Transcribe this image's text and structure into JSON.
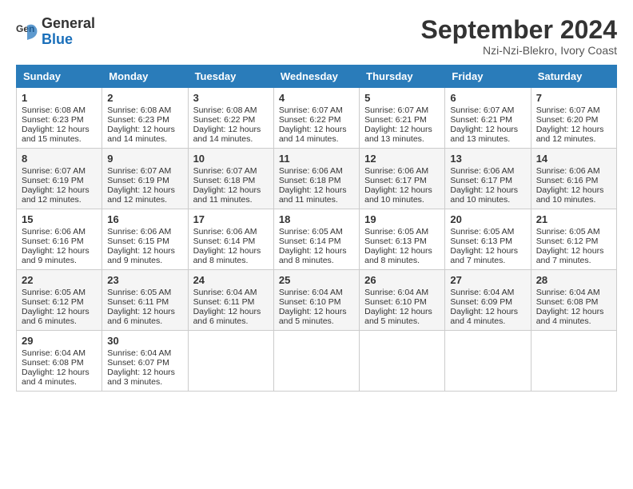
{
  "header": {
    "logo_line1": "General",
    "logo_line2": "Blue",
    "month": "September 2024",
    "location": "Nzi-Nzi-Blekro, Ivory Coast"
  },
  "weekdays": [
    "Sunday",
    "Monday",
    "Tuesday",
    "Wednesday",
    "Thursday",
    "Friday",
    "Saturday"
  ],
  "weeks": [
    [
      {
        "day": "1",
        "sunrise": "6:08 AM",
        "sunset": "6:23 PM",
        "daylight": "12 hours and 15 minutes."
      },
      {
        "day": "2",
        "sunrise": "6:08 AM",
        "sunset": "6:23 PM",
        "daylight": "12 hours and 14 minutes."
      },
      {
        "day": "3",
        "sunrise": "6:08 AM",
        "sunset": "6:22 PM",
        "daylight": "12 hours and 14 minutes."
      },
      {
        "day": "4",
        "sunrise": "6:07 AM",
        "sunset": "6:22 PM",
        "daylight": "12 hours and 14 minutes."
      },
      {
        "day": "5",
        "sunrise": "6:07 AM",
        "sunset": "6:21 PM",
        "daylight": "12 hours and 13 minutes."
      },
      {
        "day": "6",
        "sunrise": "6:07 AM",
        "sunset": "6:21 PM",
        "daylight": "12 hours and 13 minutes."
      },
      {
        "day": "7",
        "sunrise": "6:07 AM",
        "sunset": "6:20 PM",
        "daylight": "12 hours and 12 minutes."
      }
    ],
    [
      {
        "day": "8",
        "sunrise": "6:07 AM",
        "sunset": "6:19 PM",
        "daylight": "12 hours and 12 minutes."
      },
      {
        "day": "9",
        "sunrise": "6:07 AM",
        "sunset": "6:19 PM",
        "daylight": "12 hours and 12 minutes."
      },
      {
        "day": "10",
        "sunrise": "6:07 AM",
        "sunset": "6:18 PM",
        "daylight": "12 hours and 11 minutes."
      },
      {
        "day": "11",
        "sunrise": "6:06 AM",
        "sunset": "6:18 PM",
        "daylight": "12 hours and 11 minutes."
      },
      {
        "day": "12",
        "sunrise": "6:06 AM",
        "sunset": "6:17 PM",
        "daylight": "12 hours and 10 minutes."
      },
      {
        "day": "13",
        "sunrise": "6:06 AM",
        "sunset": "6:17 PM",
        "daylight": "12 hours and 10 minutes."
      },
      {
        "day": "14",
        "sunrise": "6:06 AM",
        "sunset": "6:16 PM",
        "daylight": "12 hours and 10 minutes."
      }
    ],
    [
      {
        "day": "15",
        "sunrise": "6:06 AM",
        "sunset": "6:16 PM",
        "daylight": "12 hours and 9 minutes."
      },
      {
        "day": "16",
        "sunrise": "6:06 AM",
        "sunset": "6:15 PM",
        "daylight": "12 hours and 9 minutes."
      },
      {
        "day": "17",
        "sunrise": "6:06 AM",
        "sunset": "6:14 PM",
        "daylight": "12 hours and 8 minutes."
      },
      {
        "day": "18",
        "sunrise": "6:05 AM",
        "sunset": "6:14 PM",
        "daylight": "12 hours and 8 minutes."
      },
      {
        "day": "19",
        "sunrise": "6:05 AM",
        "sunset": "6:13 PM",
        "daylight": "12 hours and 8 minutes."
      },
      {
        "day": "20",
        "sunrise": "6:05 AM",
        "sunset": "6:13 PM",
        "daylight": "12 hours and 7 minutes."
      },
      {
        "day": "21",
        "sunrise": "6:05 AM",
        "sunset": "6:12 PM",
        "daylight": "12 hours and 7 minutes."
      }
    ],
    [
      {
        "day": "22",
        "sunrise": "6:05 AM",
        "sunset": "6:12 PM",
        "daylight": "12 hours and 6 minutes."
      },
      {
        "day": "23",
        "sunrise": "6:05 AM",
        "sunset": "6:11 PM",
        "daylight": "12 hours and 6 minutes."
      },
      {
        "day": "24",
        "sunrise": "6:04 AM",
        "sunset": "6:11 PM",
        "daylight": "12 hours and 6 minutes."
      },
      {
        "day": "25",
        "sunrise": "6:04 AM",
        "sunset": "6:10 PM",
        "daylight": "12 hours and 5 minutes."
      },
      {
        "day": "26",
        "sunrise": "6:04 AM",
        "sunset": "6:10 PM",
        "daylight": "12 hours and 5 minutes."
      },
      {
        "day": "27",
        "sunrise": "6:04 AM",
        "sunset": "6:09 PM",
        "daylight": "12 hours and 4 minutes."
      },
      {
        "day": "28",
        "sunrise": "6:04 AM",
        "sunset": "6:08 PM",
        "daylight": "12 hours and 4 minutes."
      }
    ],
    [
      {
        "day": "29",
        "sunrise": "6:04 AM",
        "sunset": "6:08 PM",
        "daylight": "12 hours and 4 minutes."
      },
      {
        "day": "30",
        "sunrise": "6:04 AM",
        "sunset": "6:07 PM",
        "daylight": "12 hours and 3 minutes."
      },
      null,
      null,
      null,
      null,
      null
    ]
  ],
  "labels": {
    "sunrise_prefix": "Sunrise: ",
    "sunset_prefix": "Sunset: ",
    "daylight_prefix": "Daylight: "
  }
}
